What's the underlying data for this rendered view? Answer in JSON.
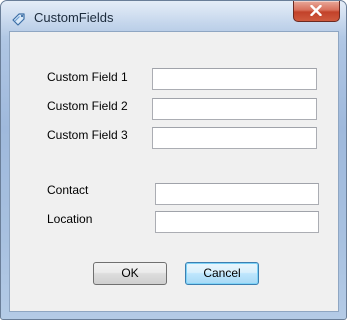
{
  "window": {
    "title": "CustomFields",
    "close_symbol": "x",
    "icon": "tag-icon"
  },
  "form": {
    "custom_field_1": {
      "label": "Custom Field 1",
      "value": ""
    },
    "custom_field_2": {
      "label": "Custom Field 2",
      "value": ""
    },
    "custom_field_3": {
      "label": "Custom Field 3",
      "value": ""
    },
    "contact": {
      "label": "Contact",
      "value": ""
    },
    "location": {
      "label": "Location",
      "value": ""
    }
  },
  "buttons": {
    "ok": "OK",
    "cancel": "Cancel"
  },
  "colors": {
    "frame_accent": "#a8c1e0",
    "close_button": "#c2422a",
    "client_background": "#f0f0f0",
    "default_button_border": "#3c7fb1"
  }
}
